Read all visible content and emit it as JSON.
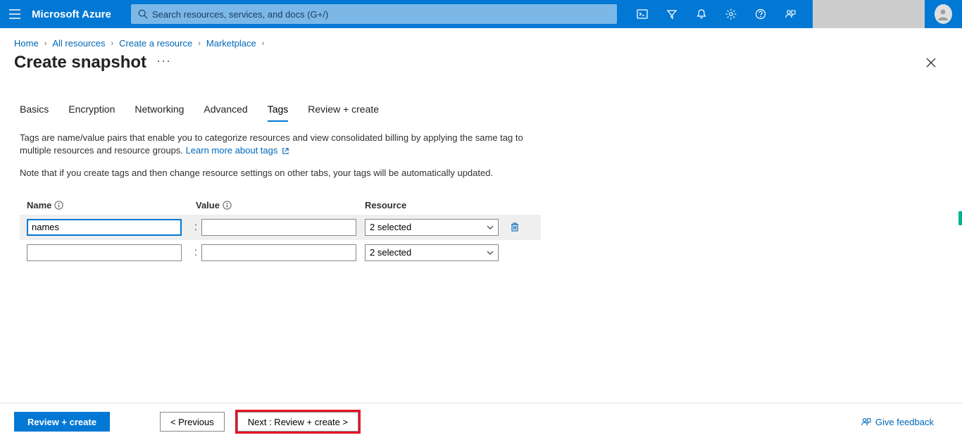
{
  "header": {
    "brand": "Microsoft Azure",
    "search_placeholder": "Search resources, services, and docs (G+/)"
  },
  "breadcrumbs": [
    "Home",
    "All resources",
    "Create a resource",
    "Marketplace"
  ],
  "page": {
    "title": "Create snapshot",
    "tabs": [
      "Basics",
      "Encryption",
      "Networking",
      "Advanced",
      "Tags",
      "Review + create"
    ],
    "active_tab_index": 4,
    "description1": "Tags are name/value pairs that enable you to categorize resources and view consolidated billing by applying the same tag to multiple resources and resource groups. ",
    "learn_more": "Learn more about tags",
    "description2": "Note that if you create tags and then change resource settings on other tabs, your tags will be automatically updated."
  },
  "tag_table": {
    "headers": {
      "name": "Name",
      "value": "Value",
      "resource": "Resource"
    },
    "colon": ":",
    "rows": [
      {
        "name_value": "names",
        "value_value": "",
        "resource_label": "2 selected",
        "deletable": true,
        "focused": true
      },
      {
        "name_value": "",
        "value_value": "",
        "resource_label": "2 selected",
        "deletable": false,
        "focused": false
      }
    ]
  },
  "footer": {
    "review_create": "Review + create",
    "previous": "< Previous",
    "next": "Next : Review + create >",
    "feedback": "Give feedback"
  }
}
